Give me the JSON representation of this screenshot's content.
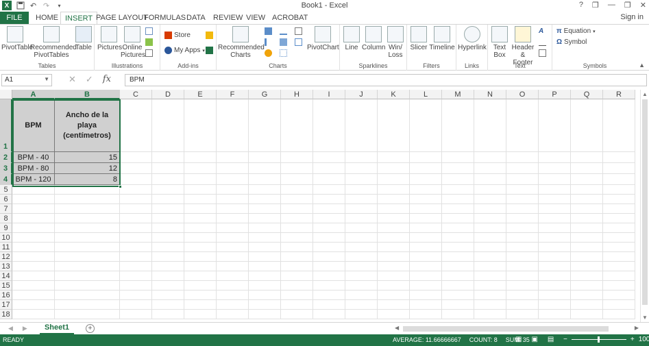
{
  "window": {
    "title": "Book1 - Excel"
  },
  "quick_access": {
    "logo": "X",
    "save_icon": "save-icon",
    "undo_icon": "undo-icon",
    "redo_icon": "redo-icon"
  },
  "window_controls": {
    "help": "?",
    "restore_ribbon": "❐",
    "minimize": "—",
    "maximize": "❐",
    "close": "✕"
  },
  "tabs": {
    "file": "FILE",
    "items": [
      "HOME",
      "INSERT",
      "PAGE LAYOUT",
      "FORMULAS",
      "DATA",
      "REVIEW",
      "VIEW",
      "ACROBAT"
    ],
    "active": "INSERT",
    "sign_in": "Sign in"
  },
  "ribbon": {
    "tables": {
      "label": "Tables",
      "pivottable": "PivotTable",
      "recommended1": "Recommended",
      "recommended2": "PivotTables",
      "table": "Table"
    },
    "illustrations": {
      "label": "Illustrations",
      "pictures": "Pictures",
      "online1": "Online",
      "online2": "Pictures"
    },
    "addins": {
      "label": "Add-ins",
      "store": "Store",
      "myapps": "My Apps"
    },
    "charts": {
      "label": "Charts",
      "recommended1": "Recommended",
      "recommended2": "Charts",
      "pivotchart": "PivotChart"
    },
    "sparklines": {
      "label": "Sparklines",
      "line": "Line",
      "column": "Column",
      "winloss1": "Win/",
      "winloss2": "Loss"
    },
    "filters": {
      "label": "Filters",
      "slicer": "Slicer",
      "timeline": "Timeline"
    },
    "links": {
      "label": "Links",
      "hyperlink": "Hyperlink"
    },
    "text": {
      "label": "Text",
      "textbox1": "Text",
      "textbox2": "Box",
      "header1": "Header",
      "header2": "& Footer"
    },
    "symbols": {
      "label": "Symbols",
      "equation": "Equation",
      "symbol": "Symbol"
    }
  },
  "formula_bar": {
    "name_box": "A1",
    "fx": "fx",
    "content": "BPM"
  },
  "columns": [
    "A",
    "B",
    "C",
    "D",
    "E",
    "F",
    "G",
    "H",
    "I",
    "J",
    "K",
    "L",
    "M",
    "N",
    "O",
    "P",
    "Q",
    "R"
  ],
  "rows": [
    "1",
    "2",
    "3",
    "4",
    "5",
    "6",
    "7",
    "8",
    "9",
    "10",
    "11",
    "12",
    "13",
    "14",
    "15",
    "16",
    "17",
    "18"
  ],
  "cells": {
    "A1": "BPM",
    "B1": "Ancho de la playa (centímetros)",
    "A2": "BPM - 40",
    "B2": "15",
    "A3": "BPM - 80",
    "B3": "12",
    "A4": "BPM - 120",
    "B4": "8"
  },
  "sheets": {
    "active": "Sheet1",
    "add": "+"
  },
  "status": {
    "ready": "READY",
    "average": "AVERAGE: 11.66666667",
    "count": "COUNT: 8",
    "sum": "SUM: 35",
    "zoom": "100%"
  },
  "colors": {
    "excel_green": "#217346",
    "data_fill": "#d0d0d0"
  }
}
